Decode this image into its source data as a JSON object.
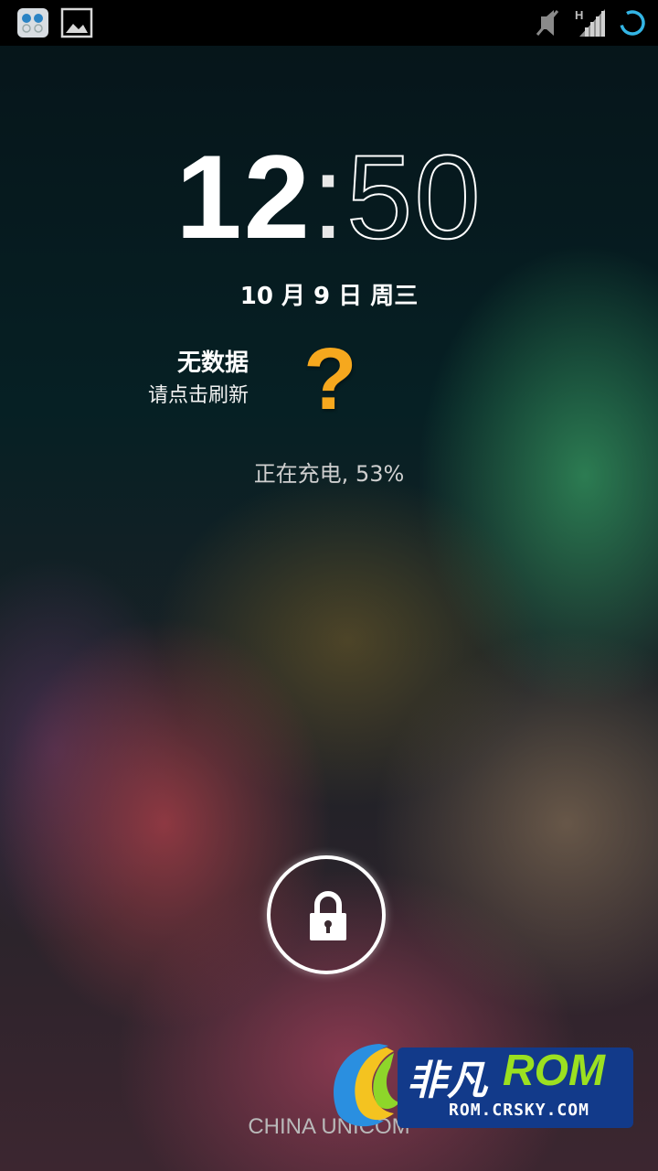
{
  "status_bar": {
    "left_icons": [
      "notification-app-icon",
      "picture-icon"
    ],
    "right_icons": [
      "mute-icon",
      "signal-h-icon",
      "loading-ring-icon"
    ],
    "network_label": "H"
  },
  "clock": {
    "hours": "12",
    "separator": ":",
    "minutes": "50"
  },
  "date": "10 月 9 日 周三",
  "weather": {
    "title": "无数据",
    "subtitle": "请点击刷新",
    "icon": "question-mark-icon",
    "icon_color": "#f6a81e"
  },
  "charging": "正在充电, 53%",
  "lock": {
    "icon": "padlock-icon"
  },
  "carrier": "CHINA UNICOM",
  "watermark": {
    "cn": "非凡",
    "rom": "ROM",
    "url": "ROM.CRSKY.COM"
  }
}
